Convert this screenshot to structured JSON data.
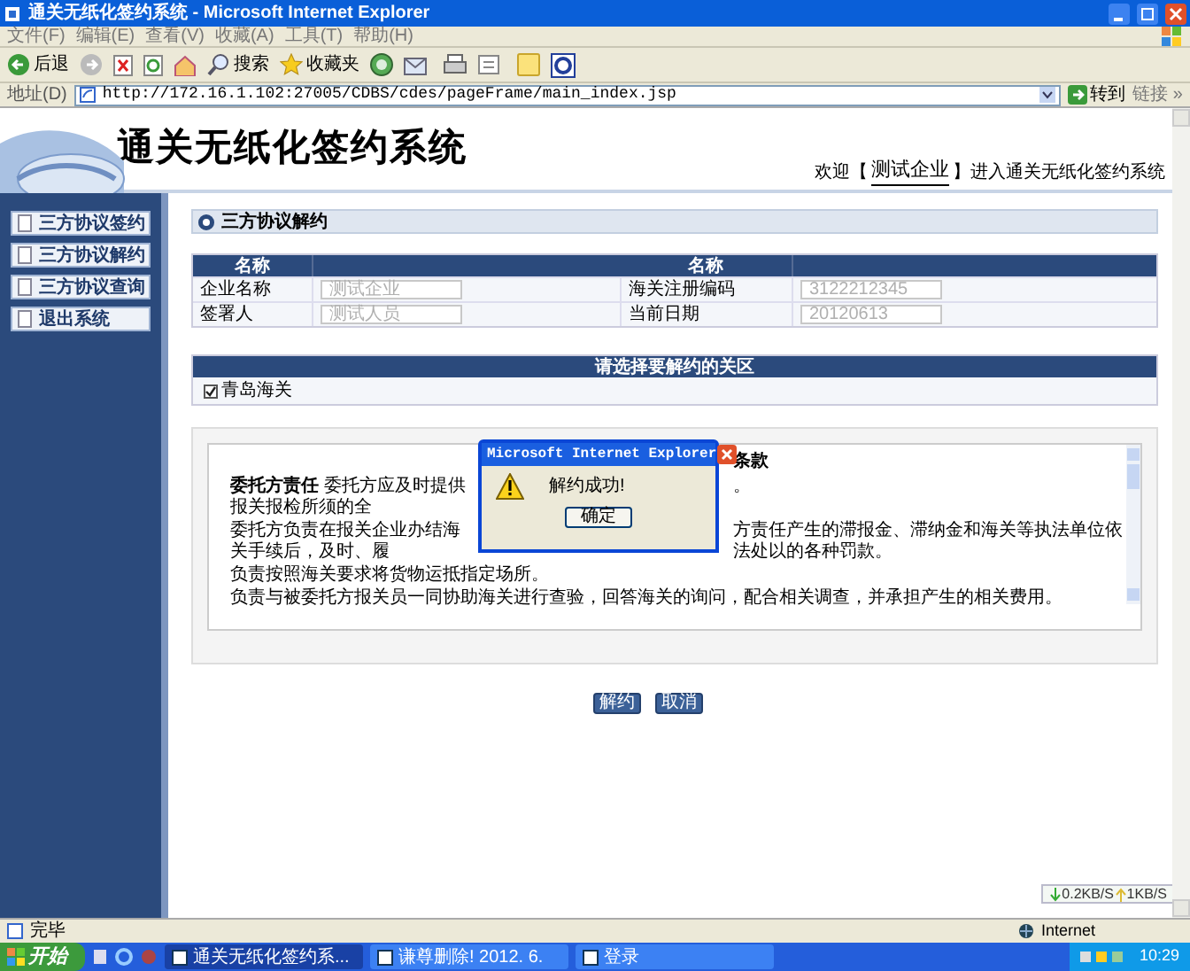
{
  "window": {
    "title": "通关无纸化签约系统 - Microsoft Internet Explorer"
  },
  "menu": [
    "文件(F)",
    "编辑(E)",
    "查看(V)",
    "收藏(A)",
    "工具(T)",
    "帮助(H)"
  ],
  "toolbar": {
    "back": "后退",
    "search": "搜索",
    "favorites": "收藏夹"
  },
  "address": {
    "label": "地址(D)",
    "url": "http://172.16.1.102:27005/CDBS/cdes/pageFrame/main_index.jsp",
    "go": "转到",
    "links": "链接 »"
  },
  "header": {
    "title": "通关无纸化签约系统",
    "welcome_prefix": "欢迎【",
    "user": "测试企业",
    "welcome_suffix": "】进入通关无纸化签约系统"
  },
  "sidebar": {
    "items": [
      {
        "label": "三方协议签约"
      },
      {
        "label": "三方协议解约"
      },
      {
        "label": "三方协议查询"
      },
      {
        "label": "退出系统"
      }
    ]
  },
  "section": {
    "title": "三方协议解约"
  },
  "info_table": {
    "columns": [
      "名称",
      "",
      "名称",
      ""
    ],
    "rows": [
      [
        "企业名称",
        "测试企业",
        "海关注册编码",
        "3122212345"
      ],
      [
        "签署人",
        "测试人员",
        "当前日期",
        "20120613"
      ]
    ]
  },
  "zone": {
    "title": "请选择要解约的关区",
    "items": [
      {
        "label": "青岛海关",
        "checked": true
      }
    ]
  },
  "clauses": {
    "heading_visible": "条款",
    "lines": [
      {
        "bold": "委托方责任",
        "left": "委托方应及时提供报关报检所须的全",
        "right": "。"
      },
      {
        "left": "委托方负责在报关企业办结海关手续后，及时、履",
        "right": "方责任产生的滞报金、滞纳金和海关等执法单位依法处以的各种罚款。"
      },
      {
        "left": "负责按照海关要求将货物运抵指定场所。"
      },
      {
        "left": "负责与被委托方报关员一同协助海关进行查验，回答海关的询问，配合相关调查，并承担产生的相关费用。"
      }
    ]
  },
  "buttons": [
    "解约",
    "取消"
  ],
  "dialog": {
    "title": "Microsoft Internet Explorer",
    "message": "解约成功!",
    "button": "确定"
  },
  "speed": {
    "down": "0.2KB/S",
    "up": "1KB/S"
  },
  "status_bar": {
    "text": "完毕",
    "zone": "Internet"
  },
  "taskbar": {
    "start": "开始",
    "items": [
      {
        "label": "通关无纸化签约系...",
        "selected": true
      },
      {
        "label": "谦尊删除! 2012. 6.",
        "selected": false
      },
      {
        "label": "登录",
        "selected": false
      }
    ],
    "clock": "10:29"
  }
}
